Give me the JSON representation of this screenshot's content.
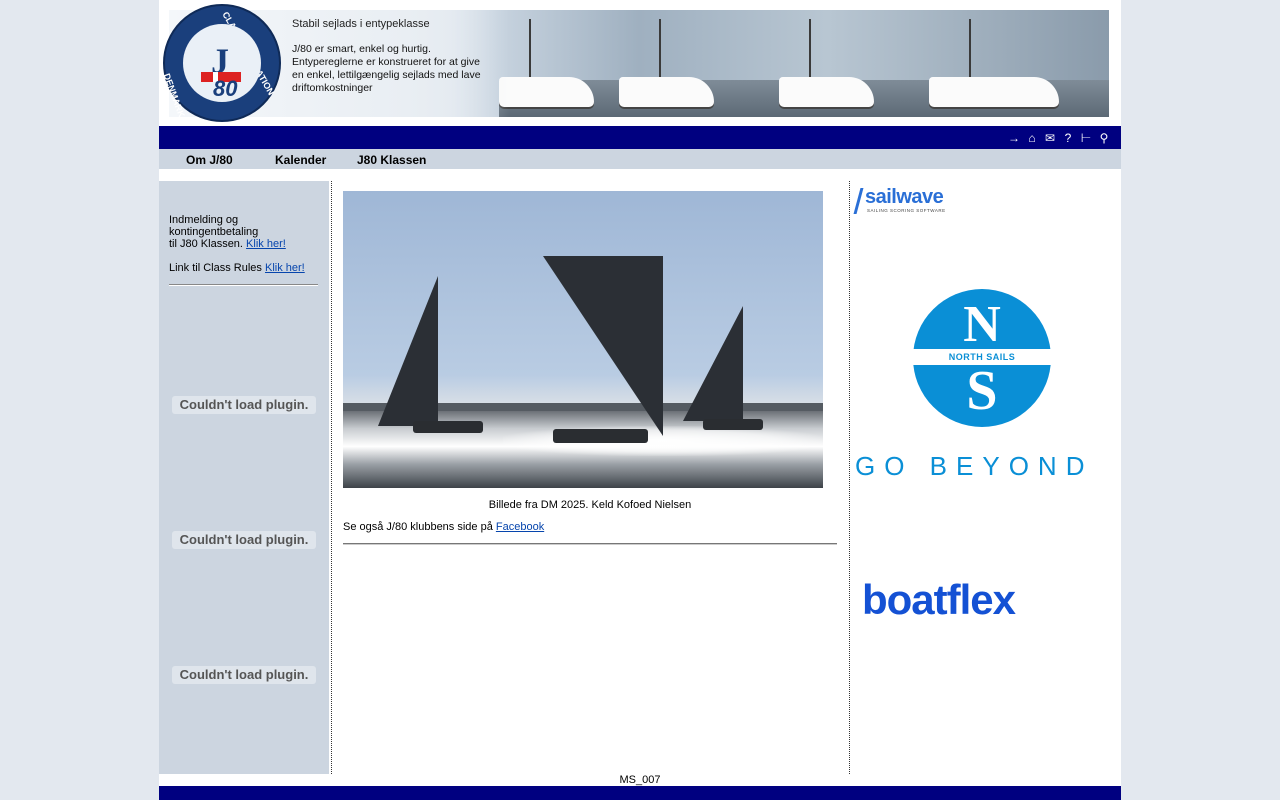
{
  "header": {
    "slogan": "Stabil sejlads i entypeklasse",
    "slogan_sub": "J/80 er smart, enkel og hurtig. Entypereglerne er konstrueret for at give en enkel, lettilgængelig sejlads med lave driftomkostninger",
    "logo_text_top": "CLASS ASSOCIATION",
    "logo_text_bottom": "DENMARK",
    "logo_j": "J",
    "logo_80": "80"
  },
  "nav_icons": [
    "arrow-right-icon",
    "home-icon",
    "mail-icon",
    "help-icon",
    "sitemap-icon",
    "search-icon"
  ],
  "menu": {
    "items": [
      {
        "label": "Om J/80"
      },
      {
        "label": "Kalender"
      },
      {
        "label": "J80 Klassen"
      }
    ]
  },
  "left": {
    "line1": "Indmelding og",
    "line2": "kontingentbetaling",
    "line3": "til J80 Klassen.",
    "link1": "Klik her!",
    "rules_prefix": "Link til Class Rules",
    "link2": "Klik her!",
    "plugin_message": "Couldn't load plugin."
  },
  "center": {
    "caption": "Billede fra DM 2025. Keld Kofoed Nielsen",
    "see_also_prefix": "Se også J/80 klubbens side på",
    "facebook_link": "Facebook"
  },
  "right": {
    "sailwave": "sailwave",
    "sailwave_sub": "SAILING SCORING SOFTWARE",
    "ns_band": "NORTH SAILS",
    "ns_n": "N",
    "ns_s": "S",
    "go_beyond": "GO BEYOND",
    "boatflex": "boatflex"
  },
  "footer": {
    "code": "MS_007"
  },
  "colors": {
    "nav_blue": "#000080",
    "menu_bg": "#ccd5e0",
    "link": "#0645ad"
  }
}
